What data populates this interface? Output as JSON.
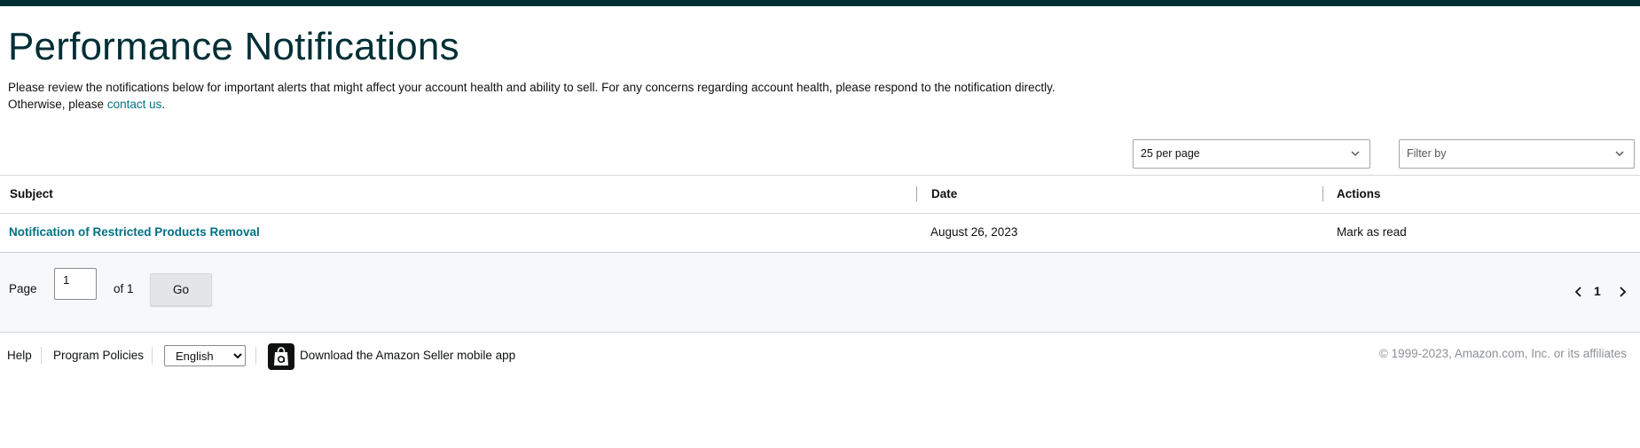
{
  "header": {
    "title": "Performance Notifications",
    "intro_text": "Please review the notifications below for important alerts that might affect your account health and ability to sell. For any concerns regarding account health, please respond to the notification directly. Otherwise, please ",
    "intro_link": "contact us",
    "intro_end": "."
  },
  "controls": {
    "per_page": "25 per page",
    "filter_placeholder": "Filter by"
  },
  "table": {
    "headers": [
      "Subject",
      "Date",
      "Actions"
    ],
    "rows": [
      {
        "subject": "Notification of Restricted Products Removal",
        "date": "August 26, 2023",
        "action": "Mark as read"
      }
    ]
  },
  "pagination": {
    "page_label": "Page",
    "page_value": "1",
    "of_label": "of 1",
    "go_label": "Go",
    "current_page": "1"
  },
  "footer": {
    "help": "Help",
    "program_policies": "Program Policies",
    "language": "English",
    "download_app": "Download the Amazon Seller mobile app",
    "copyright": "© 1999-2023, Amazon.com, Inc. or its affiliates"
  },
  "colors": {
    "brand_dark": "#002f36",
    "link": "#007185",
    "band": "#f7f8f9"
  }
}
